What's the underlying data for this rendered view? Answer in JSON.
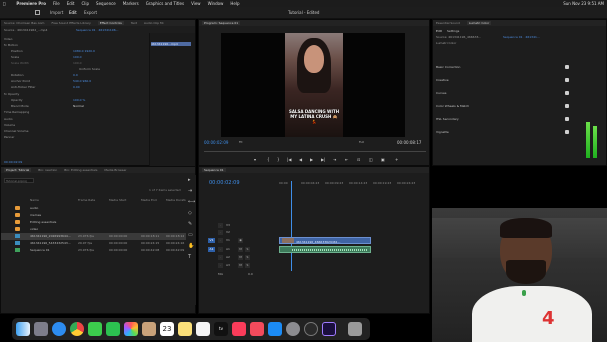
{
  "menubar": {
    "app": "Premiere Pro",
    "items": [
      "File",
      "Edit",
      "Clip",
      "Sequence",
      "Markers",
      "Graphics and Titles",
      "View",
      "Window",
      "Help"
    ],
    "clock": "Sun Nov 23  9:51 AM"
  },
  "header": {
    "tabs": [
      "Import",
      "Edit",
      "Export"
    ],
    "active_tab": "Edit",
    "title": "Tutorial - Edited"
  },
  "effect_controls": {
    "tabs": [
      "Source: Chomsen Bas Aom",
      "Free Sound Effects Library",
      "Effect Controls",
      "Text",
      "Audio Clip Mi"
    ],
    "active_tab": "Effect Controls",
    "source_label": "Source · 4613411962_...mp4",
    "seq_label": "Sequence 01 · 461341196...",
    "clip_label": "461341196...mp4",
    "video_header": "Video",
    "rows": [
      {
        "label": "fx  Motion",
        "value": ""
      },
      {
        "label": "Position",
        "value": "1080.0    1920.0"
      },
      {
        "label": "Scale",
        "value": "100.0"
      },
      {
        "label": "Scale Width",
        "value": "100.0"
      },
      {
        "label": "",
        "value": "Uniform Scale"
      },
      {
        "label": "Rotation",
        "value": "0.0"
      },
      {
        "label": "Anchor Point",
        "value": "540.0    960.0"
      },
      {
        "label": "Anti-flicker Filter",
        "value": "0.00"
      },
      {
        "label": "fx  Opacity",
        "value": ""
      },
      {
        "label": "Opacity",
        "value": "100.0 %"
      },
      {
        "label": "Blend Mode",
        "value": "Normal"
      },
      {
        "label": "Time Remapping",
        "value": ""
      },
      {
        "label": "Audio",
        "value": ""
      },
      {
        "label": "Volume",
        "value": ""
      },
      {
        "label": "Channel Volume",
        "value": ""
      },
      {
        "label": "Panner",
        "value": ""
      }
    ],
    "timecode": "00:00:02:09"
  },
  "program": {
    "title": "Program: Sequence 01",
    "caption": "SALSA DANCING WITH MY LATINA CRUSH 🙈💃",
    "timecode": "00:00:02:09",
    "fit": "Fit",
    "resolution": "Full",
    "duration": "00:00:08:17",
    "controls": [
      "▾",
      "{",
      "}",
      "|◀",
      "◀",
      "▶",
      "▶|",
      "⇥",
      "⇤",
      "⊡",
      "◫",
      "▣",
      "+"
    ]
  },
  "lumetri": {
    "tabs": [
      "Essential Sound",
      "Lumetri Color"
    ],
    "active_tab": "Lumetri Color",
    "sub_tabs": [
      "Edit",
      "Settings"
    ],
    "source_label": "Source: 461341196_466633...",
    "seq_label": "Sequence 01 · 461341...",
    "lumetri_label": "Lumetri Color",
    "sections": [
      "Basic Correction",
      "Creative",
      "Curves",
      "Color Wheels & Match",
      "HSL Secondary",
      "Vignette"
    ],
    "meter_levels": [
      0.95,
      0.85
    ]
  },
  "project": {
    "tabs": [
      "Project: Tutorial",
      "Bin: reaction",
      "Bin: Editing essentials",
      "Media Browser"
    ],
    "active_tab": "Project: Tutorial",
    "file": "Tutorial.prproj",
    "items_count": "1 of 7 items selected",
    "columns": [
      "Name",
      "Frame Rate",
      "Media Start",
      "Media End",
      "Media Duration"
    ],
    "rows": [
      {
        "kind": "folder",
        "name": "audio",
        "fr": "",
        "ms": "",
        "me": "",
        "md": ""
      },
      {
        "kind": "folder",
        "name": "memes",
        "fr": "",
        "ms": "",
        "me": "",
        "md": ""
      },
      {
        "kind": "folder",
        "name": "Editing essentials",
        "fr": "",
        "ms": "",
        "me": "",
        "md": ""
      },
      {
        "kind": "folder",
        "name": "video",
        "fr": "",
        "ms": "",
        "me": "",
        "md": ""
      },
      {
        "kind": "video",
        "name": "461341196_2026993644...",
        "fr": "23.976 fps",
        "ms": "00:00:00:00",
        "me": "00:00:18:11",
        "md": "00:00:18:12"
      },
      {
        "kind": "video",
        "name": "461341196_5433432543...",
        "fr": "29.97 fps",
        "ms": "00:00:00:00",
        "me": "00:00:24:15",
        "md": "00:00:24:16"
      },
      {
        "kind": "sequence",
        "name": "Sequence 01",
        "fr": "23.976 fps",
        "ms": "00:00:00:00",
        "me": "00:00:42:08",
        "md": "00:00:42:09"
      }
    ]
  },
  "tools": [
    "▸",
    "⇥",
    "⟷",
    "◇",
    "✎",
    "▭",
    "✋",
    "T"
  ],
  "timeline": {
    "tab": "Sequence 01",
    "timecode": "00:00:02:09",
    "ruler": [
      "00:00",
      "00:00:04:23",
      "00:00:09:23",
      "00:00:14:23",
      "00:00:19:23",
      "00:00:24:23"
    ],
    "tracks": [
      {
        "name": "V3",
        "src": ""
      },
      {
        "name": "V2",
        "src": ""
      },
      {
        "name": "V1",
        "src": "V1"
      },
      {
        "name": "A1",
        "src": "A1"
      },
      {
        "name": "A2",
        "src": ""
      },
      {
        "name": "A3",
        "src": ""
      },
      {
        "name": "Mix",
        "src": ""
      }
    ],
    "mix_value": "0.0",
    "video_clip": "461341196_466633629461...",
    "audio_clip": ""
  },
  "colors": {
    "accent_blue": "#3f8ee8",
    "clip_video": "#3f64a4",
    "clip_audio": "#3d7a5a",
    "folder": "#e79b39"
  },
  "dock": {
    "icons": [
      "finder-icon",
      "launchpad-icon",
      "safari-icon",
      "chrome-icon",
      "messages-icon",
      "facetime-icon",
      "photos-icon",
      "contacts-icon",
      "calendar-icon",
      "notes-icon",
      "reminders-icon",
      "appletv-icon",
      "music-icon",
      "news-icon",
      "appstore-icon",
      "settings-icon",
      "chatgpt-icon",
      "premiere-icon",
      "trash-icon"
    ],
    "calendar_day": "23"
  }
}
